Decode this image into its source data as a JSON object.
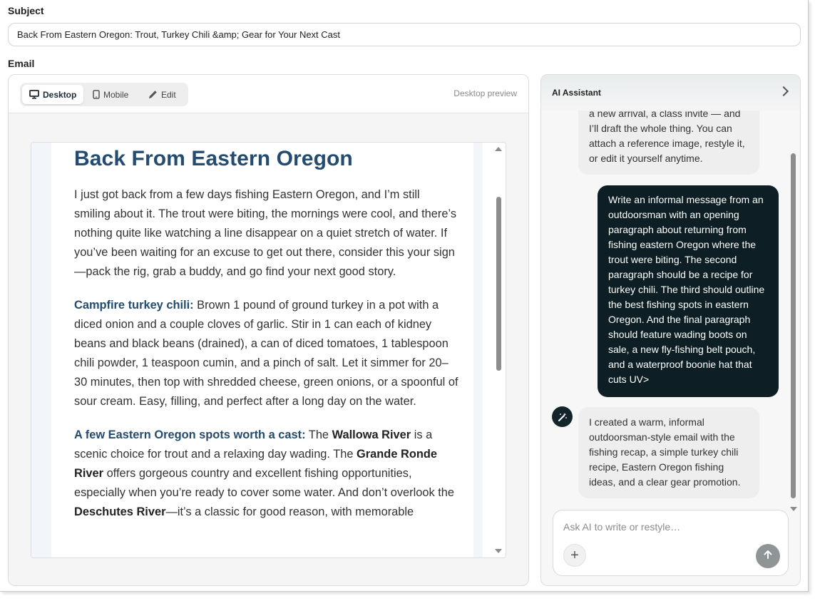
{
  "subject": {
    "label": "Subject",
    "value": "Back From Eastern Oregon: Trout, Turkey Chili &amp; Gear for Your Next Cast"
  },
  "email": {
    "label": "Email",
    "view_tabs": [
      {
        "label": "Desktop",
        "icon": "desktop-icon",
        "active": true
      },
      {
        "label": "Mobile",
        "icon": "mobile-icon",
        "active": false
      },
      {
        "label": "Edit",
        "icon": "pencil-icon",
        "active": false
      }
    ],
    "preview_mode": "Desktop preview",
    "content": {
      "heading": "Back From Eastern Oregon",
      "p1": "I just got back from a few days fishing Eastern Oregon, and I’m still smiling about it. The trout were biting, the mornings were cool, and there’s nothing quite like watching a line disappear on a quiet stretch of water. If you’ve been waiting for an excuse to get out there, consider this your sign—pack the rig, grab a buddy, and go find your next good story.",
      "p2_lead": "Campfire turkey chili:",
      "p2_body": " Brown 1 pound of ground turkey in a pot with a diced onion and a couple cloves of garlic. Stir in 1 can each of kidney beans and black beans (drained), a can of diced tomatoes, 1 tablespoon chili powder, 1 teaspoon cumin, and a pinch of salt. Let it simmer for 20–30 minutes, then top with shredded cheese, green onions, or a spoonful of sour cream. Easy, filling, and perfect after a long day on the water.",
      "p3_lead": "A few Eastern Oregon spots worth a cast:",
      "p3_t1": " The ",
      "p3_b1": "Wallowa River",
      "p3_t2": " is a scenic choice for trout and a relaxing day wading. The ",
      "p3_b2": "Grande Ronde River",
      "p3_t3": " offers gorgeous country and excellent fishing opportunities, especially when you’re ready to cover some water. And don’t overlook the ",
      "p3_b3": "Deschutes River",
      "p3_t4": "—it’s a classic for good reason, with memorable"
    },
    "scroll_position": 0.2
  },
  "assistant": {
    "title": "AI Assistant",
    "messages": [
      {
        "role": "assistant",
        "text": "a new arrival, a class invite — and I’ll draft the whole thing. You can attach a reference image, restyle it, or edit it yourself anytime."
      },
      {
        "role": "user",
        "text": "Write an informal message from an outdoorsman with an opening paragraph about returning from fishing eastern Oregon where the trout were biting. The second paragraph should be a recipe for turkey chili. The third should outline the best fishing spots in eastern Oregon. And the final paragraph should feature wading boots on sale, a new fly-fishing belt pouch, and a waterproof boonie hat that cuts UV>"
      },
      {
        "role": "assistant",
        "text": "I created a warm, informal outdoorsman-style email with the fishing recap, a simple turkey chili recipe, Eastern Oregon fishing ideas, and a clear gear promotion."
      }
    ],
    "composer": {
      "placeholder": "Ask AI to write or restyle…",
      "value": ""
    }
  },
  "colors": {
    "heading_blue": "#244c70",
    "user_bubble": "#0d1f24",
    "send_button": "#8f9496"
  }
}
